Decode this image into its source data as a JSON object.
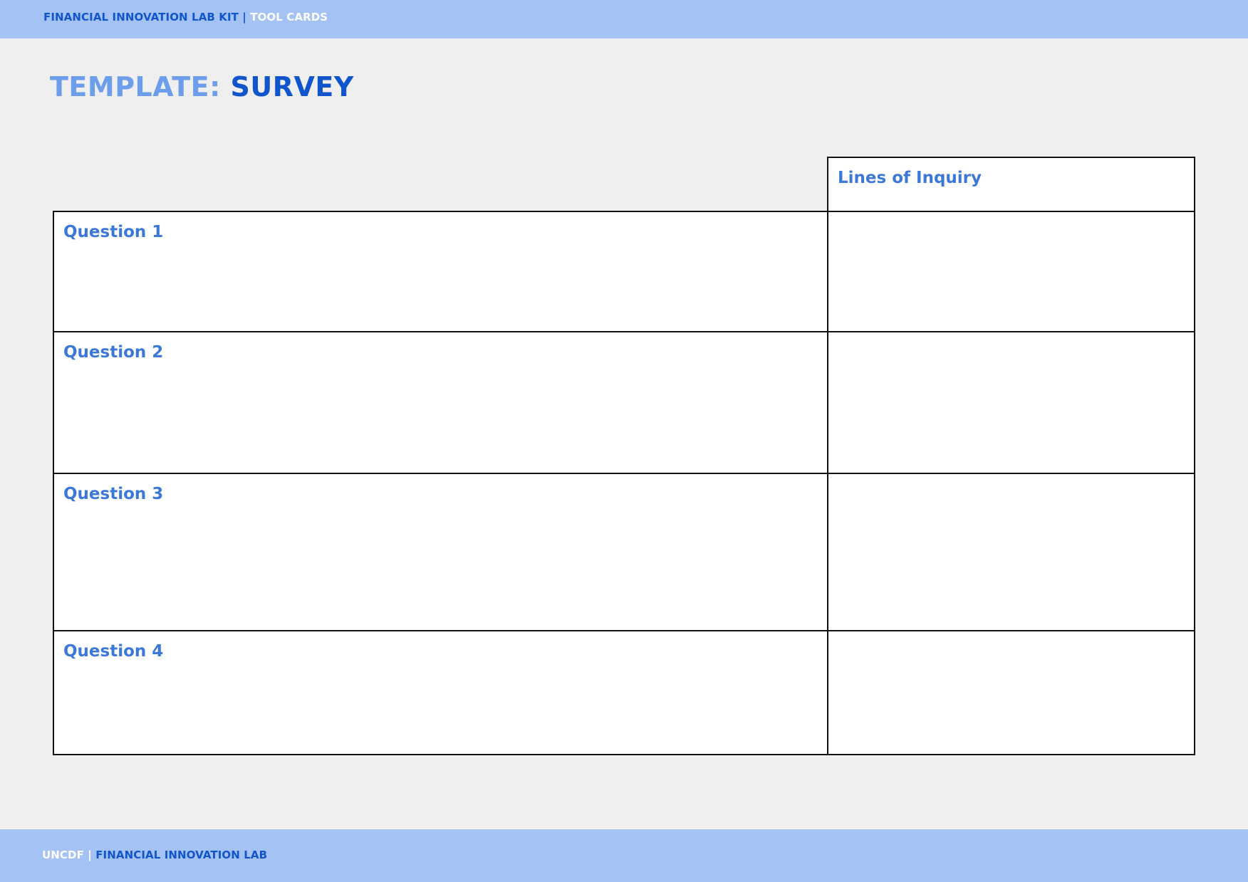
{
  "header": {
    "kit_label": "FINANCIAL INNOVATION LAB KIT",
    "separator": "|",
    "section_label": "TOOL CARDS"
  },
  "title": {
    "prefix": "TEMPLATE:",
    "name": "SURVEY"
  },
  "table": {
    "column_header": "Lines of Inquiry",
    "rows": [
      {
        "label": "Question 1"
      },
      {
        "label": "Question 2"
      },
      {
        "label": "Question 3"
      },
      {
        "label": "Question 4"
      }
    ]
  },
  "footer": {
    "org_label": "UNCDF",
    "separator": "|",
    "lab_label": "FINANCIAL INNOVATION LAB"
  },
  "colors": {
    "band": "#a4c2f4",
    "dark_blue": "#1155cc",
    "light_blue": "#6d9eeb",
    "label_blue": "#3c78d8",
    "page_background": "#efefef"
  }
}
